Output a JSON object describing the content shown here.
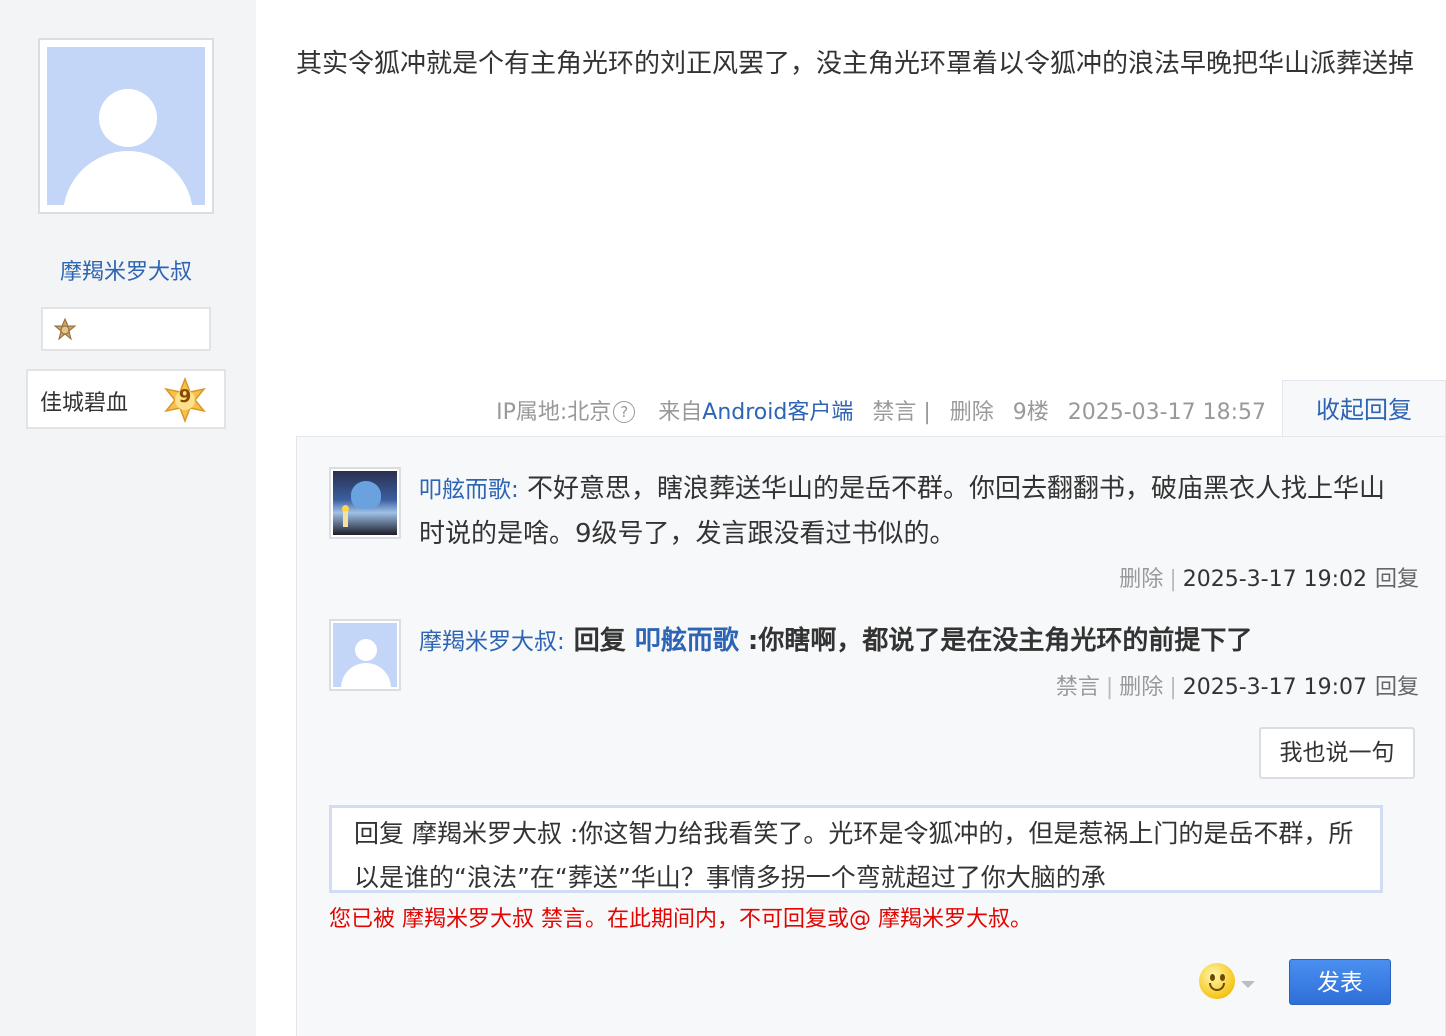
{
  "author": {
    "name": "摩羯米罗大叔",
    "forum_name": "佳城碧血",
    "level": "9"
  },
  "post": {
    "content": "其实令狐冲就是个有主角光环的刘正风罢了，没主角光环罩着以令狐冲的浪法早晚把华山派葬送掉",
    "ip_location": "IP属地:北京",
    "help_icon": "?",
    "source_prefix": "来自",
    "source_client": "Android客户端",
    "ban_label": "禁言 |",
    "delete_label": "删除",
    "floor": "9楼",
    "time": "2025-03-17 18:57",
    "collapse_label": "收起回复"
  },
  "replies": [
    {
      "user": "叩舷而歌",
      "colon": ":",
      "text": " 不好意思，瞎浪葬送华山的是岳不群。你回去翻翻书，破庙黑衣人找上华山时说的是啥。9级号了，发言跟没看过书似的。",
      "delete_label": "删除",
      "sep": "|",
      "time": "2025-3-17 19:02",
      "reply_label": "回复"
    },
    {
      "user": "摩羯米罗大叔",
      "colon": ":",
      "prefix": " 回复 ",
      "mention": "叩舷而歌",
      "text": " :你瞎啊，都说了是在没主角光环的前提下了",
      "ban_label": "禁言",
      "delete_label": "删除",
      "sep": "|",
      "time": "2025-3-17 19:07",
      "reply_label": "回复"
    }
  ],
  "composer": {
    "say_button": "我也说一句",
    "input_value": "回复 摩羯米罗大叔 :你这智力给我看笑了。光环是令狐冲的，但是惹祸上门的是岳不群，所以是谁的“浪法”在“葬送”华山？事情多拐一个弯就超过了你大脑的承",
    "ban_notice": "您已被 摩羯米罗大叔 禁言。在此期间内，不可回复或@ 摩羯米罗大叔。",
    "emoji_icon": "smiley-face",
    "submit_label": "发表"
  },
  "colors": {
    "link": "#2d64b3",
    "warning": "#e10602",
    "primary_button": "#3a7fe6"
  }
}
